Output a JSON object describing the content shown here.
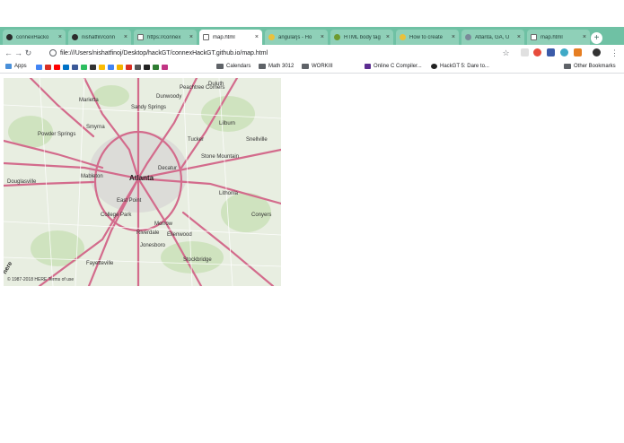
{
  "browser": {
    "tabs": [
      {
        "title": "connexHacko",
        "icon": "github-icon",
        "active": false
      },
      {
        "title": "nishatfin/conn",
        "icon": "github-icon",
        "active": false
      },
      {
        "title": "https://connex",
        "icon": "document-icon",
        "active": false
      },
      {
        "title": "map.html",
        "icon": "document-icon",
        "active": true
      },
      {
        "title": "angularjs - Ho",
        "icon": "stackoverflow-icon",
        "active": false
      },
      {
        "title": "HTML body tag",
        "icon": "w3schools-icon",
        "active": false
      },
      {
        "title": "How to create",
        "icon": "stackoverflow-icon",
        "active": false
      },
      {
        "title": "Atlanta, GA, U",
        "icon": "globe-icon",
        "active": false
      },
      {
        "title": "map.html",
        "icon": "document-icon",
        "active": false
      }
    ],
    "new_tab_label": "+",
    "address": "file:///Users/nishatfinoj/Desktop/hackGT/connexHackGT.github.io/map.html",
    "bookmarks": [
      {
        "label": "Apps",
        "type": "apps"
      },
      {
        "label": "Calendars",
        "type": "folder"
      },
      {
        "label": "Math 3012",
        "type": "folder"
      },
      {
        "label": "WORKIII",
        "type": "folder"
      },
      {
        "label": "Online C Compiler...",
        "type": "link"
      },
      {
        "label": "HackGT 5: Dare to...",
        "type": "link"
      }
    ],
    "other_bookmarks": "Other Bookmarks"
  },
  "map": {
    "center_city": "Atlanta",
    "cities": [
      "Marietta",
      "Sandy Springs",
      "Dunwoody",
      "Peachtree Corners",
      "Smyrna",
      "Decatur",
      "Tucker",
      "Stone Mountain",
      "Snellville",
      "Lithonia",
      "Conyers",
      "Mableton",
      "East Point",
      "College Park",
      "Morrow",
      "Ellenwood",
      "Riverdale",
      "Jonesboro",
      "Stockbridge",
      "Douglasville",
      "Fayetteville",
      "Powder Springs",
      "Lilburn",
      "Duluth"
    ],
    "copyright": "© 1987-2018 HERE  Terms of use",
    "logo": "here"
  },
  "colors": {
    "tabstrip": "#6fc1a4",
    "highway": "#d36b8c",
    "map_bg": "#e8eee1"
  }
}
